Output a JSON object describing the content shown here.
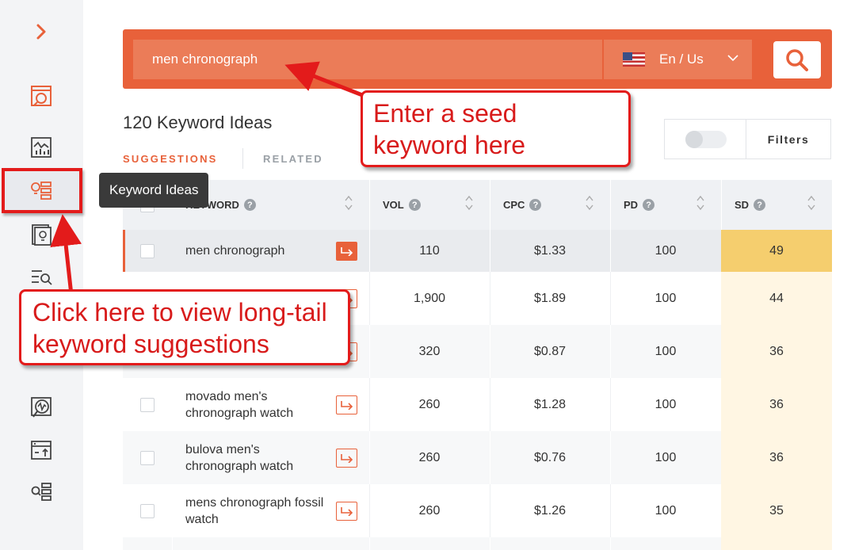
{
  "search": {
    "query": "men chronograph",
    "locale_label": "En / Us"
  },
  "results": {
    "title": "120 Keyword Ideas",
    "tabs": [
      "SUGGESTIONS",
      "RELATED"
    ],
    "filters_label": "Filters"
  },
  "tooltip": "Keyword Ideas",
  "table": {
    "headers": {
      "keyword": "KEYWORD",
      "vol": "VOL",
      "cpc": "CPC",
      "pd": "PD",
      "sd": "SD"
    },
    "rows": [
      {
        "keyword": "men chronograph",
        "vol": "110",
        "cpc": "$1.33",
        "pd": "100",
        "sd": "49"
      },
      {
        "keyword": "",
        "vol": "1,900",
        "cpc": "$1.89",
        "pd": "100",
        "sd": "44"
      },
      {
        "keyword": "",
        "vol": "320",
        "cpc": "$0.87",
        "pd": "100",
        "sd": "36"
      },
      {
        "keyword": "movado men's chronograph watch",
        "vol": "260",
        "cpc": "$1.28",
        "pd": "100",
        "sd": "36"
      },
      {
        "keyword": "bulova men's chronograph watch",
        "vol": "260",
        "cpc": "$0.76",
        "pd": "100",
        "sd": "36"
      },
      {
        "keyword": "mens chronograph fossil watch",
        "vol": "260",
        "cpc": "$1.26",
        "pd": "100",
        "sd": "35"
      }
    ]
  },
  "callouts": {
    "seed": "Enter a seed keyword here",
    "longtail": "Click here to view long-tail keyword suggestions"
  },
  "colors": {
    "accent": "#e8613a",
    "annotation_red": "#e31b1b",
    "sd_high": "#f5ce6e",
    "sd_low": "#fff6e3"
  },
  "icons": [
    "chevron-right-icon",
    "dashboard-icon",
    "chart-icon",
    "keyword-ideas-icon",
    "content-ideas-icon",
    "serp-icon",
    "site-audit-icon",
    "upload-icon",
    "search-list-icon",
    "search-icon",
    "chevron-down-icon",
    "sort-icon",
    "arrow-go-icon"
  ]
}
